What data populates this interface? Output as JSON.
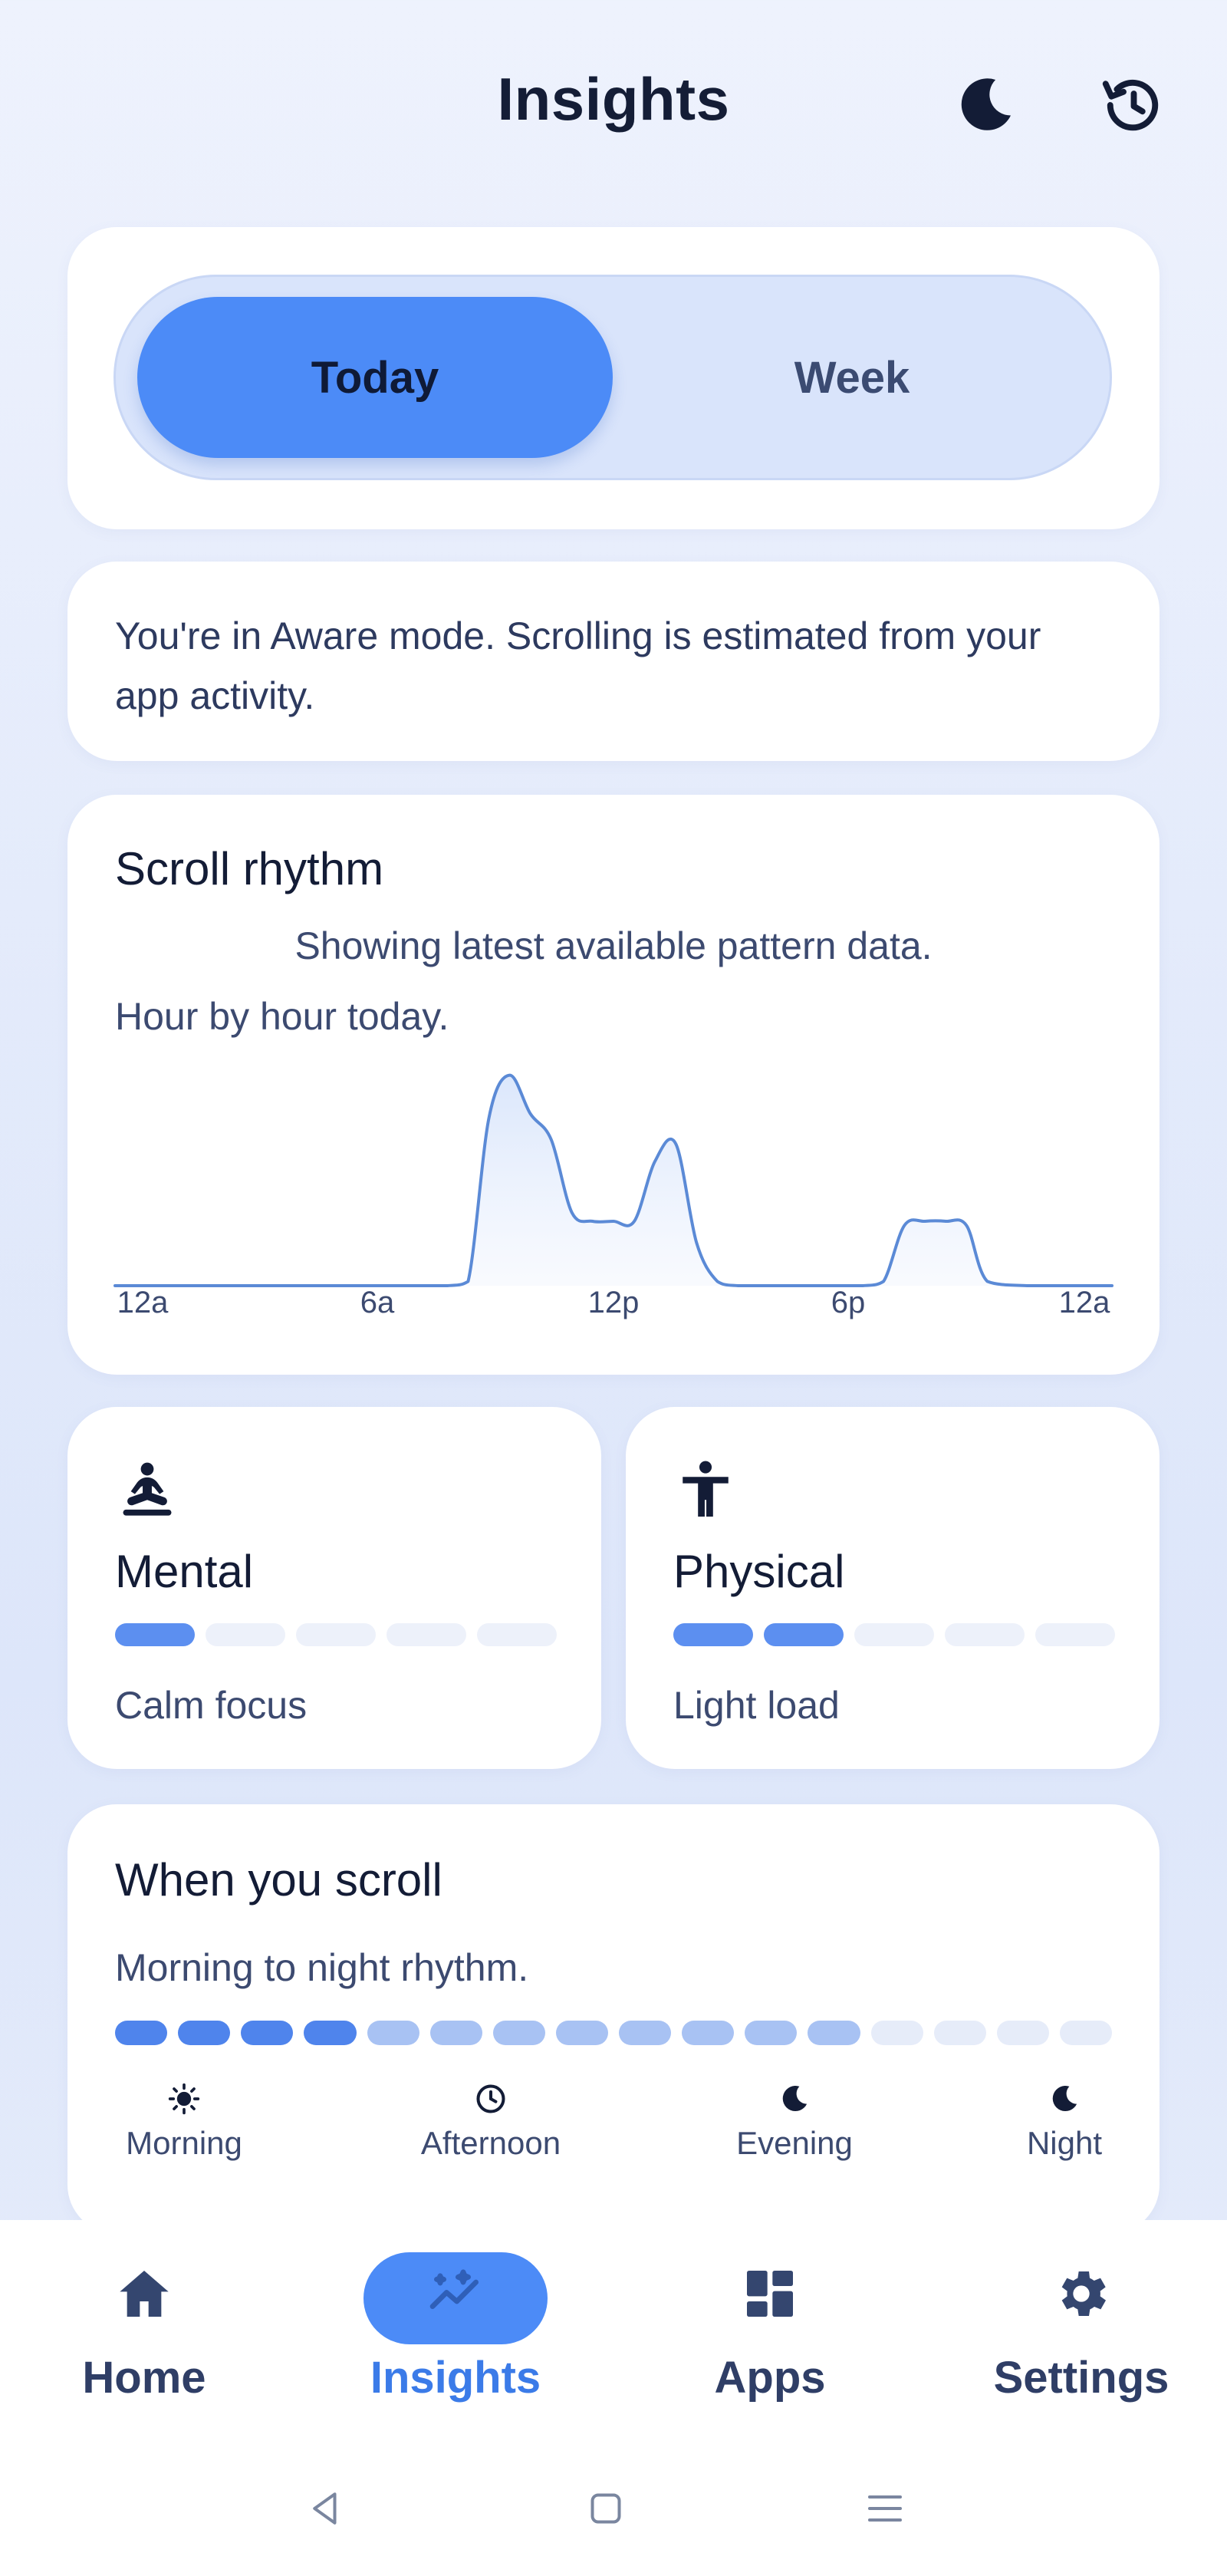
{
  "header": {
    "title": "Insights",
    "icons": [
      "moon-icon",
      "history-icon"
    ]
  },
  "segmented": {
    "options": [
      "Today",
      "Week"
    ],
    "selected": "Today"
  },
  "info": {
    "text": "You're in Aware mode. Scrolling is estimated from your app activity."
  },
  "scroll_rhythm": {
    "title": "Scroll rhythm",
    "subtitle": "Showing latest available pattern data.",
    "caption": "Hour by hour today.",
    "chart_data": {
      "type": "area",
      "x_unit": "hour",
      "xlim": [
        0,
        24
      ],
      "ylim": [
        0,
        1
      ],
      "x_ticks": [
        "12a",
        "6a",
        "12p",
        "6p",
        "12a"
      ],
      "x": [
        0,
        1,
        2,
        3,
        4,
        5,
        6,
        7,
        8,
        8.5,
        9,
        9.5,
        10,
        10.5,
        11,
        11.5,
        12,
        12.5,
        13,
        13.5,
        14,
        14.5,
        15,
        16,
        17,
        18,
        18.5,
        19,
        19.5,
        20,
        20.5,
        21,
        22,
        23,
        24
      ],
      "y": [
        0,
        0,
        0,
        0,
        0,
        0,
        0,
        0,
        0,
        0.02,
        0.78,
        0.98,
        0.8,
        0.68,
        0.34,
        0.3,
        0.3,
        0.3,
        0.58,
        0.66,
        0.2,
        0.02,
        0,
        0,
        0,
        0,
        0.02,
        0.28,
        0.3,
        0.3,
        0.28,
        0.02,
        0,
        0,
        0
      ],
      "grid": false,
      "line_color": "#5b8ad6",
      "fill_color": "#e6eefb"
    }
  },
  "mental": {
    "title": "Mental",
    "value": "Calm focus",
    "level": 1,
    "max_level": 5,
    "icon": "meditation-icon"
  },
  "physical": {
    "title": "Physical",
    "value": "Light load",
    "level": 2,
    "max_level": 5,
    "icon": "person-standing-icon"
  },
  "when": {
    "title": "When you scroll",
    "caption": "Morning to night rhythm.",
    "levels": [
      3,
      3,
      3,
      3,
      2,
      2,
      2,
      2,
      2,
      2,
      2,
      2,
      1,
      1,
      1,
      1
    ],
    "periods": [
      {
        "label": "Morning",
        "icon": "sun-icon"
      },
      {
        "label": "Afternoon",
        "icon": "clock-icon"
      },
      {
        "label": "Evening",
        "icon": "moon-icon"
      },
      {
        "label": "Night",
        "icon": "moon-icon"
      }
    ]
  },
  "nav": {
    "items": [
      {
        "label": "Home",
        "icon": "home-icon"
      },
      {
        "label": "Insights",
        "icon": "insights-icon"
      },
      {
        "label": "Apps",
        "icon": "apps-icon"
      },
      {
        "label": "Settings",
        "icon": "gear-icon"
      }
    ],
    "active": "Insights"
  },
  "system_nav": [
    "back-icon",
    "home-square-icon",
    "recents-menu-icon"
  ],
  "colors": {
    "accent": "#4c8bf7",
    "active_label": "#3b7be8",
    "bar_on": "#5c8ff0",
    "text_dark": "#131c36",
    "text_muted": "#3c4a70"
  }
}
